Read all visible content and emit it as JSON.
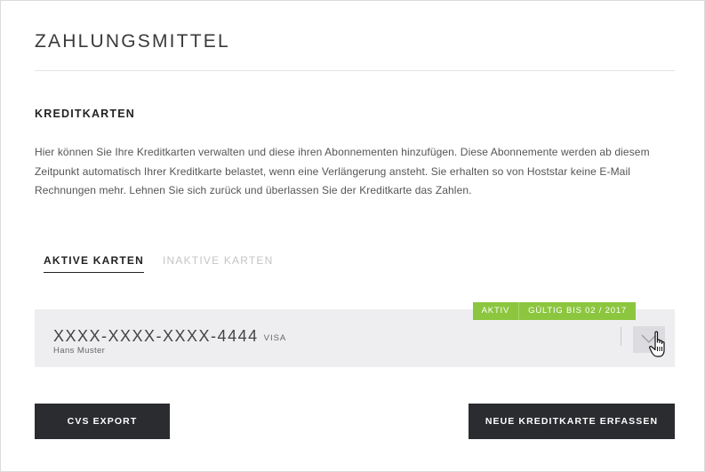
{
  "header": {
    "title": "ZAHLUNGSMITTEL"
  },
  "section": {
    "title": "KREDITKARTEN",
    "description": "Hier können Sie Ihre Kreditkarten verwalten und diese ihren Abonnementen hinzufügen. Diese Abonnemente werden ab diesem Zeitpunkt automatisch Ihrer Kreditkarte belastet, wenn eine Verlängerung ansteht. Sie erhalten so von Hoststar keine E-Mail Rechnungen mehr. Lehnen Sie sich zurück und überlassen Sie der Kreditkarte das Zahlen."
  },
  "tabs": [
    {
      "label": "AKTIVE KARTEN",
      "active": true
    },
    {
      "label": "INAKTIVE KARTEN",
      "active": false
    }
  ],
  "cards": [
    {
      "number": "XXXX-XXXX-XXXX-4444",
      "brand": "VISA",
      "holder": "Hans Muster",
      "status": "AKTIV",
      "valid": "GÜLTIG BIS 02 / 2017"
    }
  ],
  "actions": {
    "export_label": "CVS EXPORT",
    "new_card_label": "NEUE KREDITKARTE ERFASSEN"
  },
  "colors": {
    "accent_green": "#8cc63f",
    "button_dark": "#2b2c30",
    "card_bg": "#eeeef1"
  },
  "icons": {
    "expand": "chevron-down-icon",
    "cursor": "hand-pointer-icon"
  }
}
